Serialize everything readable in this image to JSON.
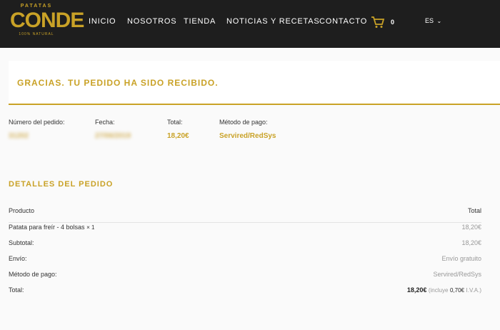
{
  "brand": {
    "top": "PATATAS",
    "main": "CONDE",
    "tag": "100% NATURAL"
  },
  "nav": [
    "INICIO",
    "NOSOTROS",
    "TIENDA",
    "NOTICIAS Y RECETAS",
    "CONTACTO"
  ],
  "cart": {
    "count": "0"
  },
  "lang": "ES",
  "thanks": "GRACIAS. TU PEDIDO HA SIDO RECIBIDO.",
  "overview": {
    "order_label": "Número del pedido:",
    "order_value": "31202",
    "date_label": "Fecha:",
    "date_value": "27/06/2019",
    "total_label": "Total:",
    "total_value": "18,20€",
    "method_label": "Método de pago:",
    "method_value": "Servired/RedSys"
  },
  "details": {
    "title": "DETALLES DEL PEDIDO",
    "head_product": "Producto",
    "head_total": "Total",
    "item_name": "Patata para freír - 4 bolsas",
    "item_qty": "× 1",
    "item_total": "18,20€",
    "subtotal_label": "Subtotal:",
    "subtotal_value": "18,20€",
    "shipping_label": "Envío:",
    "shipping_value": "Envío gratuito",
    "method_label": "Método de pago:",
    "method_value": "Servired/RedSys",
    "total_label": "Total:",
    "total_value": "18,20€",
    "total_note_pre": "(incluye",
    "total_tax": "0,70€",
    "total_note_post": "I.V.A.)"
  },
  "colors": {
    "accent": "#c9a227",
    "header": "#1e1e1e"
  },
  "icons": {
    "cart": "cart-icon",
    "lang_caret": "chevron-down-icon"
  }
}
